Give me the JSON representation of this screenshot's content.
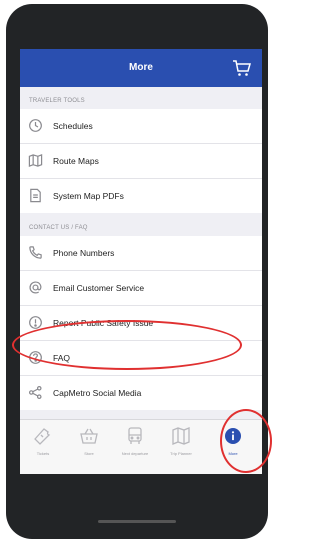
{
  "header": {
    "title": "More",
    "cart_icon": "shopping-cart-icon"
  },
  "traveler_tools": {
    "header": "TRAVELER TOOLS",
    "items": [
      {
        "label": "Schedules",
        "icon": "clock-icon"
      },
      {
        "label": "Route Maps",
        "icon": "map-icon"
      },
      {
        "label": "System Map PDFs",
        "icon": "document-icon"
      }
    ]
  },
  "contact": {
    "header": "CONTACT US / FAQ",
    "items": [
      {
        "label": "Phone Numbers",
        "icon": "phone-icon"
      },
      {
        "label": "Email Customer Service",
        "icon": "at-sign-icon"
      },
      {
        "label": "Report Public Safety Issue",
        "icon": "alert-icon"
      },
      {
        "label": "FAQ",
        "icon": "question-icon"
      },
      {
        "label": "CapMetro Social Media",
        "icon": "share-icon"
      }
    ]
  },
  "tabs": [
    {
      "label": "Tickets",
      "icon": "ticket-icon",
      "active": false
    },
    {
      "label": "Store",
      "icon": "shopping-basket-icon",
      "active": false
    },
    {
      "label": "Next departure",
      "icon": "bus-icon",
      "active": false
    },
    {
      "label": "Trip Planner",
      "icon": "map-icon",
      "active": false
    },
    {
      "label": "More",
      "icon": "more-icon",
      "active": true
    }
  ],
  "colors": {
    "nav_bar": "#2a4fb0",
    "annotation": "#e03030",
    "background": "#efeff4"
  }
}
